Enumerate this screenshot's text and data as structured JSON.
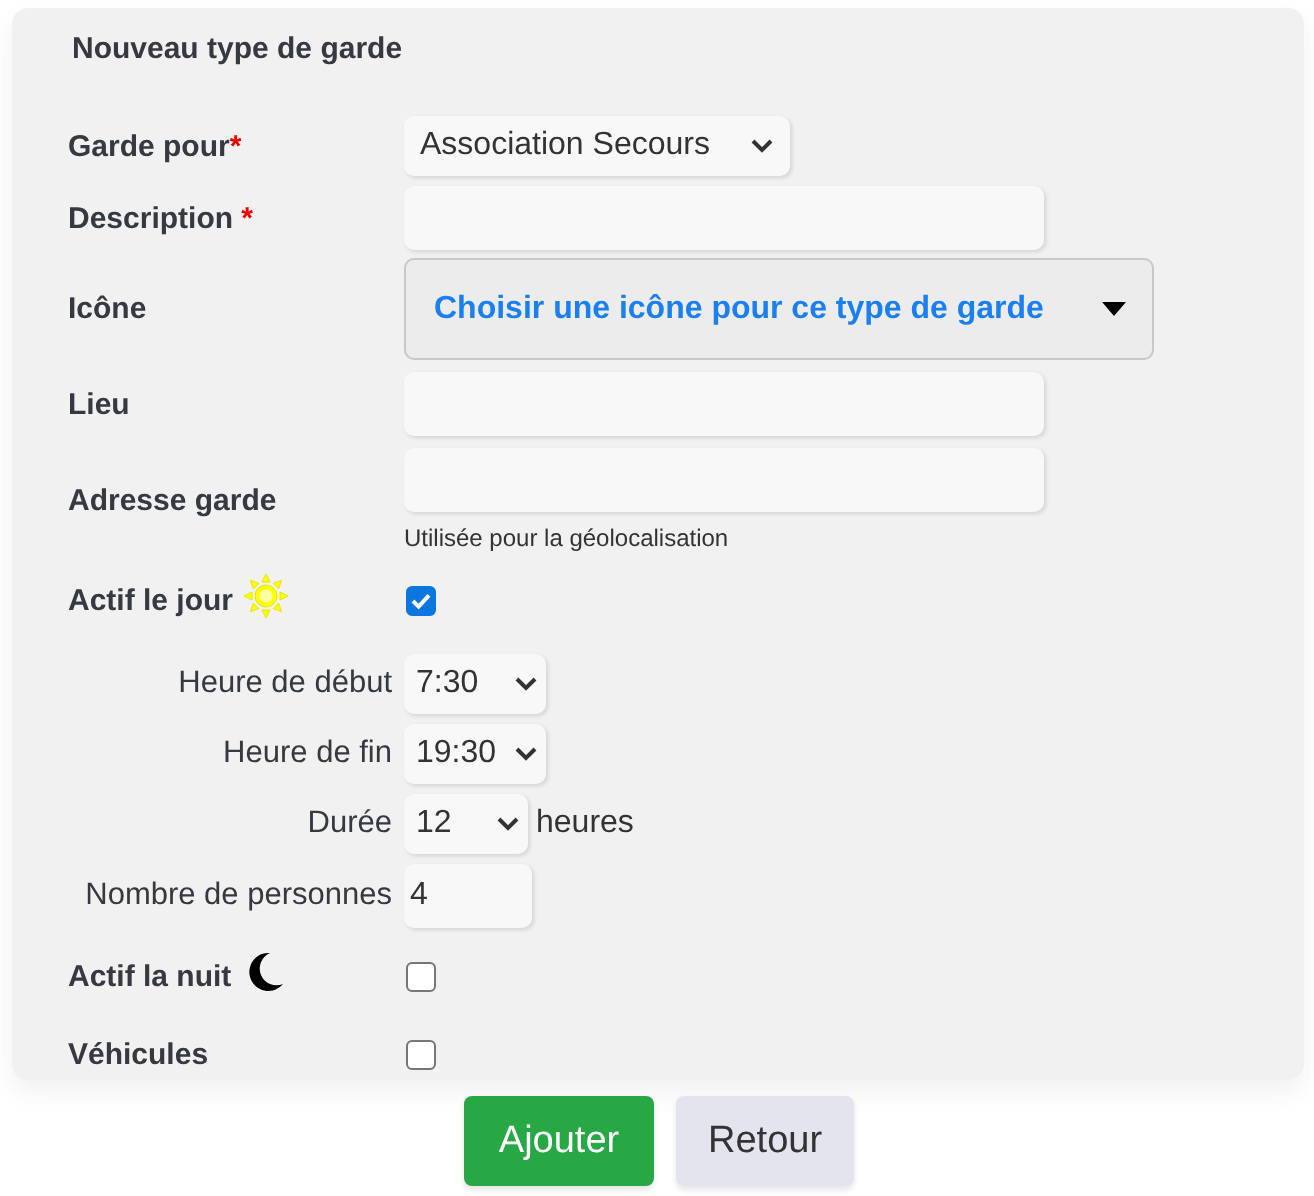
{
  "form": {
    "title": "Nouveau type de garde",
    "rows": [
      {
        "kind": "select",
        "label": "Garde pour",
        "required_mark": "*",
        "value": "Association Secours"
      },
      {
        "kind": "text",
        "label": "Description",
        "required_mark": " *"
      },
      {
        "kind": "picker",
        "label": "Icône",
        "value": "Choisir une icône pour ce type de garde"
      },
      {
        "kind": "text",
        "label": "Lieu"
      },
      {
        "kind": "text",
        "label": "Adresse garde",
        "help": "Utilisée pour la géolocalisation"
      },
      {
        "kind": "daytoggle",
        "label": "Actif le jour",
        "checked": true
      },
      {
        "kind": "timeselect",
        "label": "Heure de début",
        "value": "7:30"
      },
      {
        "kind": "timeselect",
        "label": "Heure de fin",
        "value": "19:30"
      },
      {
        "kind": "durationselect",
        "label": "Durée",
        "value": "12",
        "unit": "heures"
      },
      {
        "kind": "count",
        "label": "Nombre de personnes",
        "value": "4"
      },
      {
        "kind": "nighttoggle",
        "label": "Actif la nuit",
        "checked": false
      },
      {
        "kind": "checkbox",
        "label": "Véhicules",
        "checked": false
      }
    ]
  },
  "buttons": [
    {
      "label": "Ajouter",
      "kind": "primary"
    },
    {
      "label": "Retour",
      "kind": "secondary"
    }
  ]
}
